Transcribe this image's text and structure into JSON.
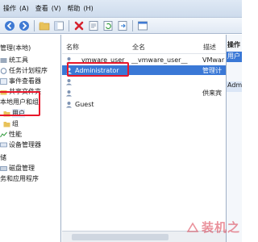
{
  "menubar": {
    "items": [
      "操作",
      "(A)",
      "查看",
      "(V)",
      "帮助",
      "(H)"
    ]
  },
  "toolbar": {
    "buttons": [
      "back-icon",
      "forward-icon",
      "up-folder-icon",
      "show-hide-tree-icon",
      "delete-icon",
      "properties-icon",
      "refresh-icon",
      "export-list-icon",
      "help-icon",
      "view-icon"
    ]
  },
  "tree": {
    "nodes": [
      {
        "label": "管理(本地)"
      },
      {
        "label": "统工具"
      },
      {
        "label": "任务计划程序"
      },
      {
        "label": "事件查看器"
      },
      {
        "label": "共享文件夹"
      },
      {
        "label": "本地用户和组"
      },
      {
        "label": "用户"
      },
      {
        "label": "组"
      },
      {
        "label": "性能"
      },
      {
        "label": "设备管理器"
      },
      {
        "label": "储"
      },
      {
        "label": "磁盘管理"
      },
      {
        "label": "务和应用程序"
      }
    ]
  },
  "list": {
    "columns": [
      "名称",
      "全名",
      "描述"
    ],
    "rows": [
      {
        "name": "__vmware_user__",
        "fullname": "__vmware_user__",
        "desc": "VMwar"
      },
      {
        "name": "Administrator",
        "fullname": "",
        "desc": "管理计"
      },
      {
        "name": "",
        "fullname": "",
        "desc": ""
      },
      {
        "name": "",
        "fullname": "",
        "desc": "供来宾"
      },
      {
        "name": "Guest",
        "fullname": "",
        "desc": ""
      }
    ]
  },
  "actions": {
    "header": "操作",
    "users_item": "用户",
    "admin_item": "Adm"
  },
  "watermark": {
    "text": "装机之"
  },
  "colors": {
    "highlight": "#e8172b",
    "selection": "#3a78d6",
    "menubar": "#cddbec"
  }
}
